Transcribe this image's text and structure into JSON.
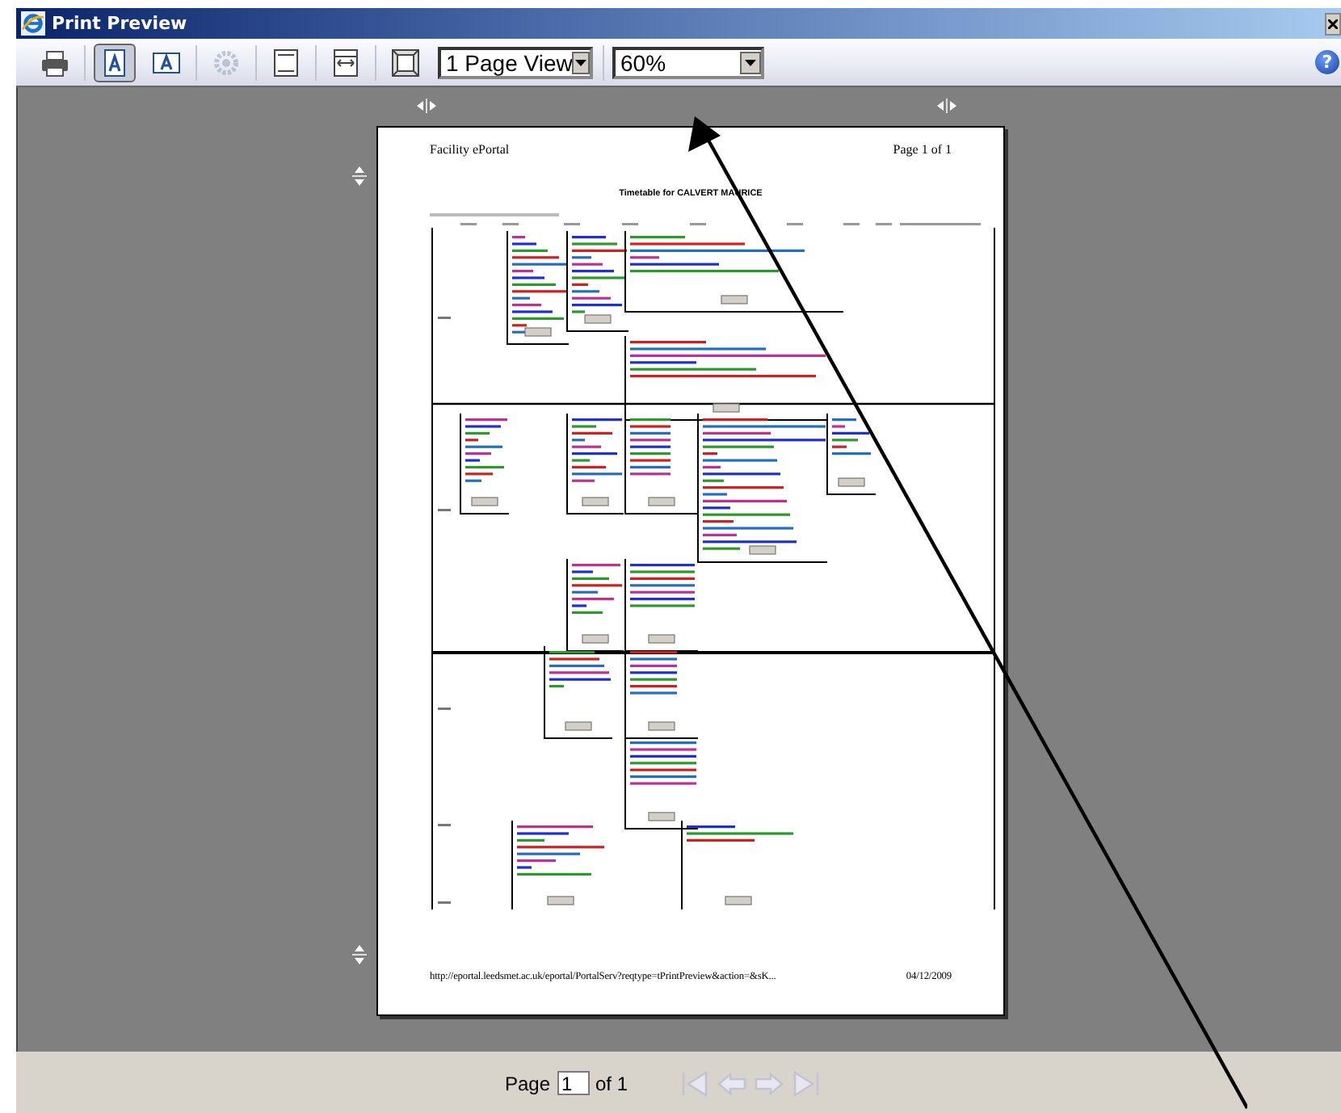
{
  "window": {
    "title": "Print Preview"
  },
  "toolbar": {
    "buttons": [
      {
        "kind": "print",
        "selected": false,
        "disabled": false
      },
      {
        "kind": "portrait",
        "selected": true,
        "disabled": false
      },
      {
        "kind": "landscape",
        "selected": false,
        "disabled": false
      },
      {
        "kind": "setup",
        "selected": false,
        "disabled": true
      },
      {
        "kind": "headers",
        "selected": false,
        "disabled": false
      },
      {
        "kind": "fit-width",
        "selected": false,
        "disabled": false
      },
      {
        "kind": "fit-page",
        "selected": false,
        "disabled": false
      }
    ],
    "view_select": {
      "value": "1 Page View"
    },
    "zoom_select": {
      "value": "60%"
    },
    "help_button": {
      "label": "?"
    }
  },
  "page": {
    "header_left": "Facility ePortal",
    "header_right": "Page 1 of 1",
    "title": "Timetable for CALVERT MAURICE",
    "footer_url": "http://eportal.leedsmet.ac.uk/eportal/PortalServ?reqtype=tPrintPreview&action=&sK...",
    "footer_date": "04/12/2009"
  },
  "pager": {
    "label": "Page",
    "value": "1",
    "total": "of 1",
    "nav": [
      {
        "kind": "first",
        "disabled": true
      },
      {
        "kind": "prev",
        "disabled": true
      },
      {
        "kind": "next",
        "disabled": true
      },
      {
        "kind": "last",
        "disabled": true
      }
    ]
  }
}
